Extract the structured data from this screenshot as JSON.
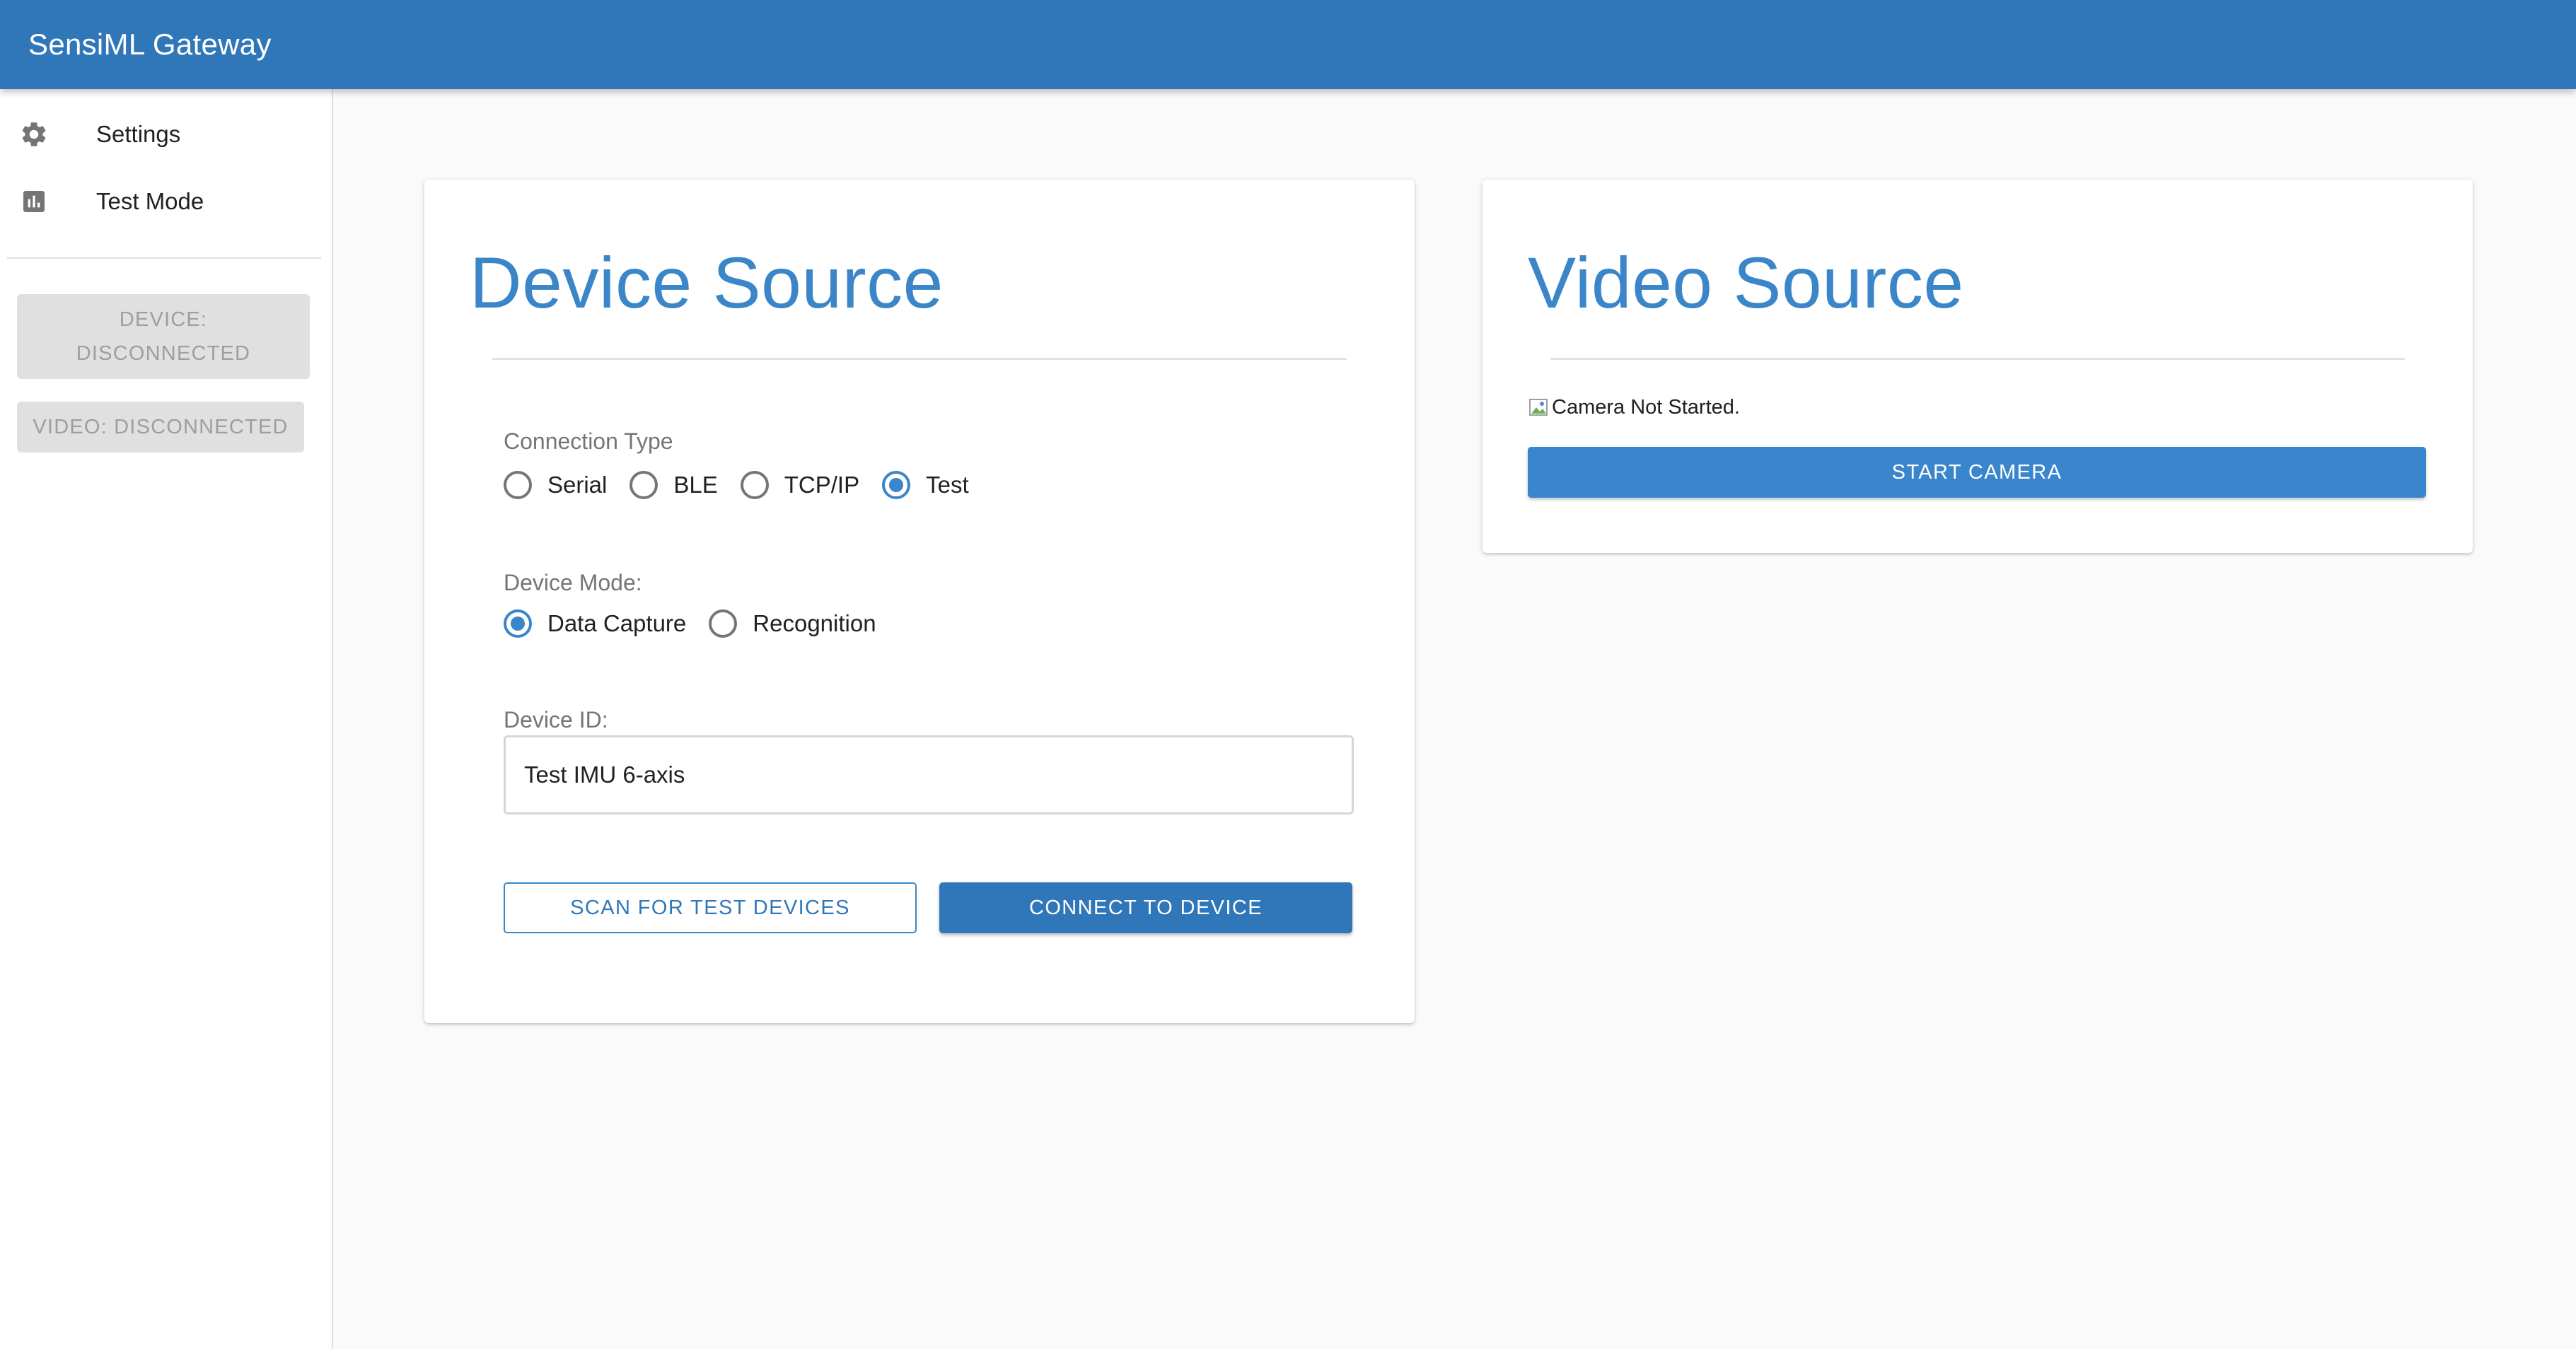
{
  "appbar": {
    "title": "SensiML Gateway"
  },
  "sidebar": {
    "items": [
      {
        "label": "Settings",
        "icon": "gear-icon"
      },
      {
        "label": "Test Mode",
        "icon": "bar-chart-icon"
      }
    ],
    "device_status_line1": "DEVICE:",
    "device_status_line2": "DISCONNECTED",
    "video_status": "VIDEO: DISCONNECTED"
  },
  "device_source": {
    "title": "Device Source",
    "connection_type_label": "Connection Type",
    "connection_types": [
      {
        "label": "Serial",
        "selected": false
      },
      {
        "label": "BLE",
        "selected": false
      },
      {
        "label": "TCP/IP",
        "selected": false
      },
      {
        "label": "Test",
        "selected": true
      }
    ],
    "device_mode_label": "Device Mode:",
    "device_modes": [
      {
        "label": "Data Capture",
        "selected": true
      },
      {
        "label": "Recognition",
        "selected": false
      }
    ],
    "device_id_label": "Device ID:",
    "device_id_value": "Test IMU 6-axis",
    "scan_button": "SCAN FOR TEST DEVICES",
    "connect_button": "CONNECT TO DEVICE"
  },
  "video_source": {
    "title": "Video Source",
    "camera_alt_text": "Camera Not Started.",
    "start_button": "START CAMERA"
  },
  "colors": {
    "primary": "#3077ba",
    "accent": "#3a86c8",
    "disabled_bg": "#e0e0e0",
    "disabled_text": "#9e9e9e"
  }
}
